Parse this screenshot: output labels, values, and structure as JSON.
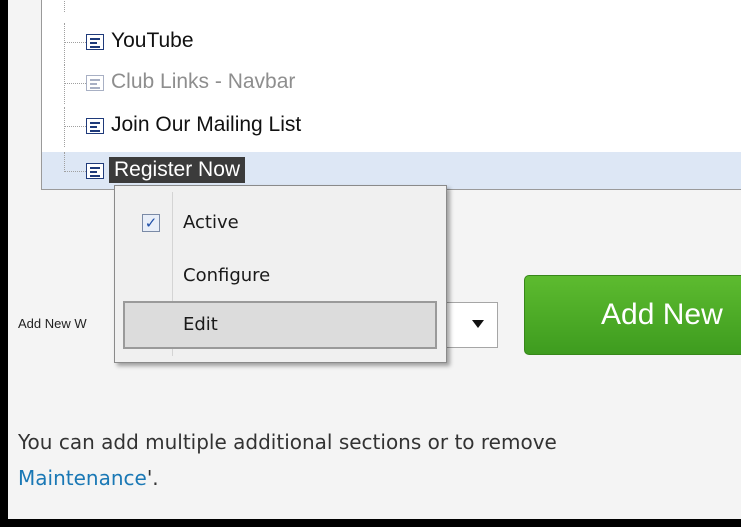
{
  "tree": {
    "items": [
      {
        "label": "YouTube",
        "state": "normal"
      },
      {
        "label": "Club Links - Navbar",
        "state": "disabled"
      },
      {
        "label": "Join Our Mailing List",
        "state": "normal"
      },
      {
        "label": "Register Now",
        "state": "selected"
      }
    ]
  },
  "add_widget": {
    "label": "Add New W",
    "button_label": "Add New"
  },
  "context_menu": {
    "items": [
      {
        "label": "Active",
        "checked": true
      },
      {
        "label": "Configure"
      },
      {
        "label": "Edit",
        "hovered": true
      }
    ]
  },
  "info": {
    "line1": "You can add multiple additional sections or to remove",
    "link": "Maintenance",
    "tail": "'."
  },
  "colors": {
    "accent_green": "#4caf28",
    "link_blue": "#1a78b5",
    "selection_bg": "#dde7f5"
  }
}
